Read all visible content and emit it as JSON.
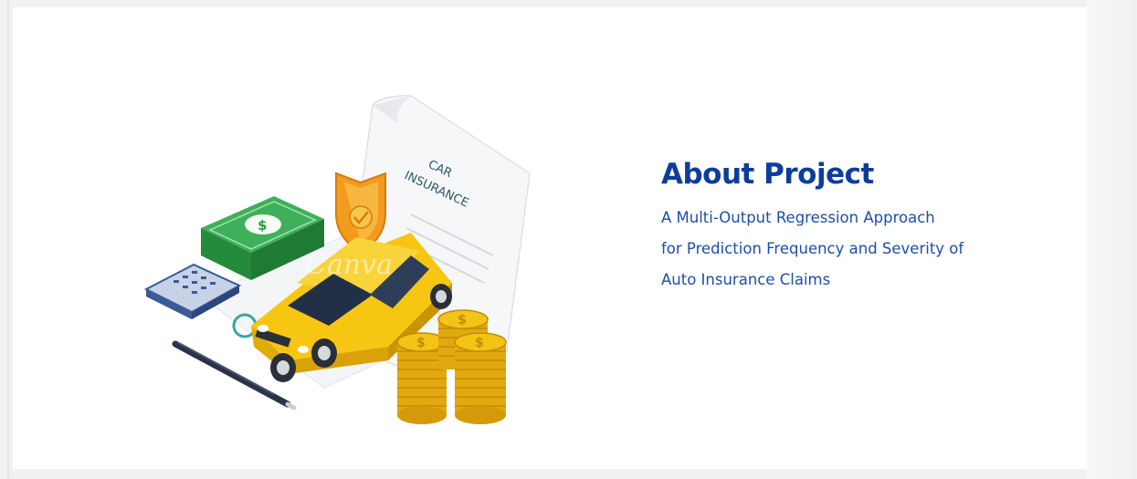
{
  "illustration": {
    "document_text_line1": "CAR",
    "document_text_line2": "INSURANCE",
    "watermark": "Canva",
    "icons": [
      "cash-stack-icon",
      "calculator-icon",
      "shield-check-icon",
      "car-icon",
      "coin-stack-icon",
      "pen-icon",
      "document-icon"
    ],
    "colors": {
      "car": "#f7c613",
      "cash": "#2e9a44",
      "shield": "#f39b1d",
      "coins": "#f3c316",
      "calculator": "#3a5a98"
    }
  },
  "about": {
    "title": "About Project",
    "description_lines": [
      "A Multi-Output Regression Approach",
      "for Prediction Frequency and Severity of",
      "Auto Insurance Claims"
    ]
  },
  "colors": {
    "title": "#0d3d9c",
    "text": "#1c4ea8",
    "background": "#ffffff"
  }
}
